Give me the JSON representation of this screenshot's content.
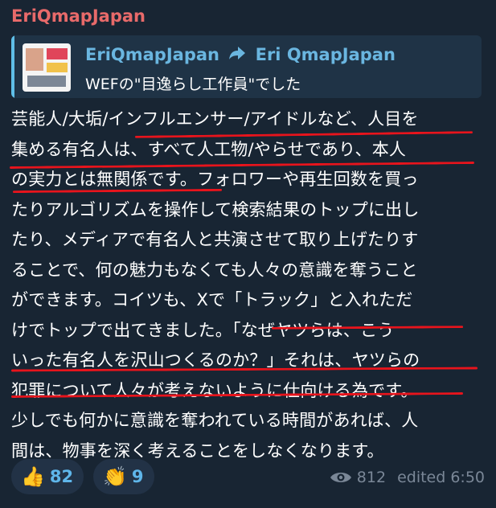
{
  "message": {
    "sender": "EriQmapJapan",
    "reply": {
      "author": "EriQmapJapan",
      "forward_to": "Eri QmapJapan",
      "text": "WEFの\"目逸らし工作員\"でした"
    },
    "body_lines": [
      "芸能人/大垢/インフルエンサー/アイドルなど、人目を",
      "集める有名人は、すべて人工物/やらせであり、本人",
      "の実力とは無関係です。フォロワーや再生回数を買っ",
      "たりアルゴリズムを操作して検索結果のトップに出し",
      "たり、メディアで有名人と共演させて取り上げたりす",
      "ることで、何の魅力もなくても人々の意識を奪うこと",
      "ができます。コイツも、Xで「トラック」と入れただ",
      "けでトップで出てきました。「なぜヤツらは、こう",
      "いった有名人を沢山つくるのか？」それは、ヤツらの",
      "犯罪について人々が考えないように仕向ける為です。",
      "少しでも何かに意識を奪われている時間があれば、人",
      "間は、物事を深く考えることをしなくなります。"
    ],
    "reactions": [
      {
        "emoji": "👍",
        "icon": "thumbs-up-icon",
        "count": "82"
      },
      {
        "emoji": "👏",
        "icon": "clapping-hands-icon",
        "count": "9"
      }
    ],
    "views": "812",
    "edited": "edited 6:50"
  },
  "colors": {
    "background": "#182533",
    "sender": "#e86a6a",
    "reply_author": "#6ab6e0",
    "underline": "#e8141c",
    "reaction_count": "#5fb6ea",
    "meta": "#7a8797"
  }
}
